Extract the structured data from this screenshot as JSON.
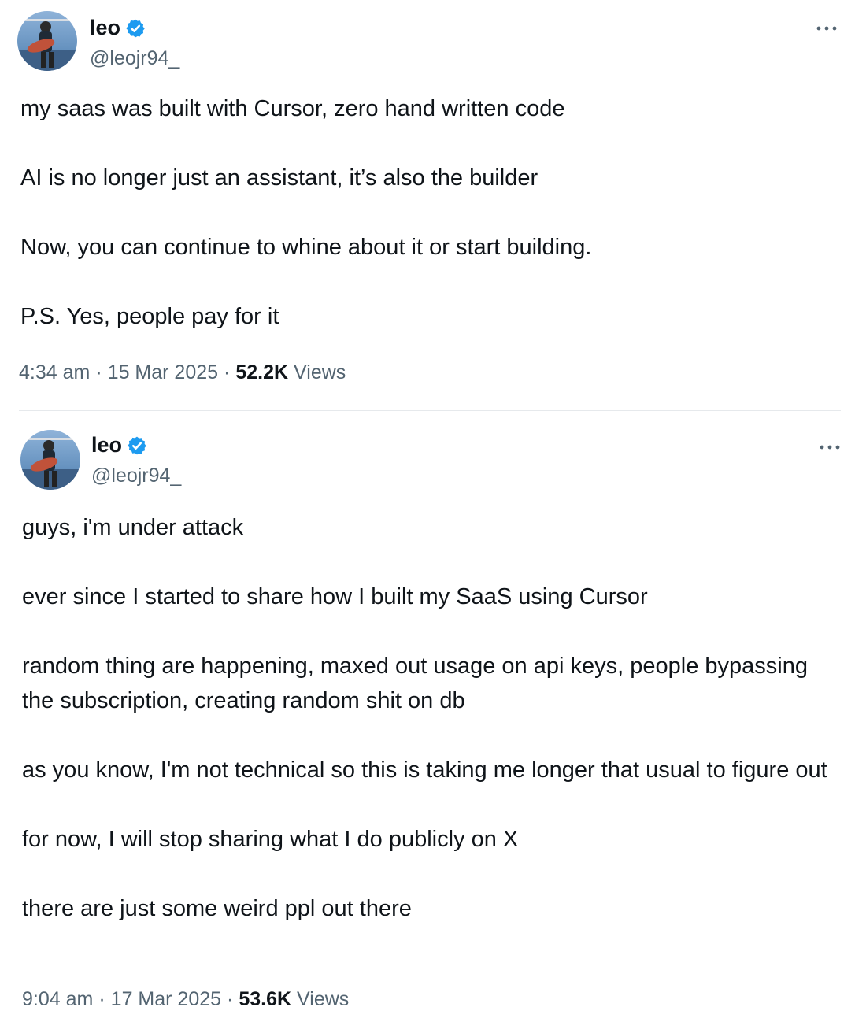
{
  "tweets": [
    {
      "display_name": "leo",
      "handle": "@leojr94_",
      "verified_icon": "verified-badge-icon",
      "more_icon": "more-options-icon",
      "paragraphs": [
        "my saas was built with Cursor, zero hand written code",
        "AI is no longer just an assistant, it’s also the builder",
        "Now, you can continue to whine about it or start building.",
        "P.S. Yes, people pay for it"
      ],
      "time": "4:34 am",
      "date": "15 Mar 2025",
      "views_count": "52.2K",
      "views_label": "Views"
    },
    {
      "display_name": "leo",
      "handle": "@leojr94_",
      "verified_icon": "verified-badge-icon",
      "more_icon": "more-options-icon",
      "paragraphs": [
        "guys, i'm under attack",
        "ever since I started to share how I built my SaaS using Cursor",
        "random thing are happening, maxed out usage on api keys, people bypassing the subscription, creating random shit on db",
        "as you know, I'm not technical so this is taking me longer that usual to figure out",
        "for now, I will stop sharing what I do publicly on X",
        "there are just some weird ppl out there"
      ],
      "time": "9:04 am",
      "date": "17 Mar 2025",
      "views_count": "53.6K",
      "views_label": "Views"
    }
  ],
  "separator": "·",
  "colors": {
    "text": "#0f1419",
    "secondary": "#536471",
    "verified_blue": "#1d9bf0",
    "divider": "#e6e9ec"
  }
}
